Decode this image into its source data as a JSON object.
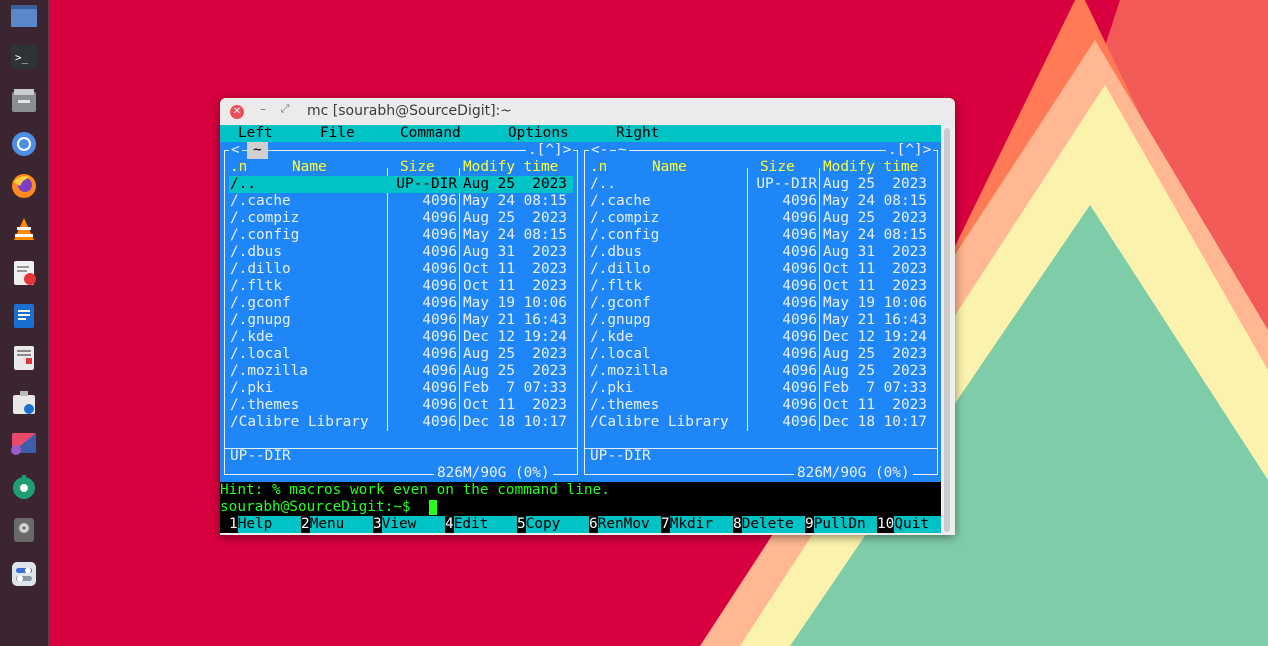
{
  "window": {
    "title": "mc [sourabh@SourceDigit]:~"
  },
  "menu": [
    "Left",
    "File",
    "Command",
    "Options",
    "Right"
  ],
  "left_panel": {
    "path_prefix": "<",
    "path": "~",
    "path_suffix": ".[^]>",
    "headers": {
      "sort": ".n",
      "name": "Name",
      "size": "Size",
      "time": "Modify time"
    },
    "rows": [
      {
        "name": "/..",
        "size": "UP--DIR",
        "time": "Aug 25  2023",
        "selected": true
      },
      {
        "name": "/.cache",
        "size": "4096",
        "time": "May 24 08:15"
      },
      {
        "name": "/.compiz",
        "size": "4096",
        "time": "Aug 25  2023"
      },
      {
        "name": "/.config",
        "size": "4096",
        "time": "May 24 08:15"
      },
      {
        "name": "/.dbus",
        "size": "4096",
        "time": "Aug 31  2023"
      },
      {
        "name": "/.dillo",
        "size": "4096",
        "time": "Oct 11  2023"
      },
      {
        "name": "/.fltk",
        "size": "4096",
        "time": "Oct 11  2023"
      },
      {
        "name": "/.gconf",
        "size": "4096",
        "time": "May 19 10:06"
      },
      {
        "name": "/.gnupg",
        "size": "4096",
        "time": "May 21 16:43"
      },
      {
        "name": "/.kde",
        "size": "4096",
        "time": "Dec 12 19:24"
      },
      {
        "name": "/.local",
        "size": "4096",
        "time": "Aug 25  2023"
      },
      {
        "name": "/.mozilla",
        "size": "4096",
        "time": "Aug 25  2023"
      },
      {
        "name": "/.pki",
        "size": "4096",
        "time": "Feb  7 07:33"
      },
      {
        "name": "/.themes",
        "size": "4096",
        "time": "Oct 11  2023"
      },
      {
        "name": "/Calibre Library",
        "size": "4096",
        "time": "Dec 18 10:17"
      }
    ],
    "status": "UP--DIR",
    "disk": "826M/90G (0%)"
  },
  "right_panel": {
    "path_prefix": "<-",
    "path": "~",
    "path_suffix": ".[^]>",
    "headers": {
      "sort": ".n",
      "name": "Name",
      "size": "Size",
      "time": "Modify time"
    },
    "rows": [
      {
        "name": "/..",
        "size": "UP--DIR",
        "time": "Aug 25  2023"
      },
      {
        "name": "/.cache",
        "size": "4096",
        "time": "May 24 08:15"
      },
      {
        "name": "/.compiz",
        "size": "4096",
        "time": "Aug 25  2023"
      },
      {
        "name": "/.config",
        "size": "4096",
        "time": "May 24 08:15"
      },
      {
        "name": "/.dbus",
        "size": "4096",
        "time": "Aug 31  2023"
      },
      {
        "name": "/.dillo",
        "size": "4096",
        "time": "Oct 11  2023"
      },
      {
        "name": "/.fltk",
        "size": "4096",
        "time": "Oct 11  2023"
      },
      {
        "name": "/.gconf",
        "size": "4096",
        "time": "May 19 10:06"
      },
      {
        "name": "/.gnupg",
        "size": "4096",
        "time": "May 21 16:43"
      },
      {
        "name": "/.kde",
        "size": "4096",
        "time": "Dec 12 19:24"
      },
      {
        "name": "/.local",
        "size": "4096",
        "time": "Aug 25  2023"
      },
      {
        "name": "/.mozilla",
        "size": "4096",
        "time": "Aug 25  2023"
      },
      {
        "name": "/.pki",
        "size": "4096",
        "time": "Feb  7 07:33"
      },
      {
        "name": "/.themes",
        "size": "4096",
        "time": "Oct 11  2023"
      },
      {
        "name": "/Calibre Library",
        "size": "4096",
        "time": "Dec 18 10:17"
      }
    ],
    "status": "UP--DIR",
    "disk": "826M/90G (0%)"
  },
  "hint": "Hint: % macros work even on the command line.",
  "prompt": "sourabh@SourceDigit:~$",
  "fkeys": [
    {
      "num": "1",
      "label": "Help"
    },
    {
      "num": "2",
      "label": "Menu"
    },
    {
      "num": "3",
      "label": "View"
    },
    {
      "num": "4",
      "label": "Edit"
    },
    {
      "num": "5",
      "label": "Copy"
    },
    {
      "num": "6",
      "label": "RenMov"
    },
    {
      "num": "7",
      "label": "Mkdir"
    },
    {
      "num": "8",
      "label": "Delete"
    },
    {
      "num": "9",
      "label": "PullDn"
    },
    {
      "num": "10",
      "label": "Quit"
    }
  ],
  "dock": [
    {
      "name": "show-desktop-icon"
    },
    {
      "name": "terminal-icon"
    },
    {
      "name": "file-manager-icon"
    },
    {
      "name": "chromium-icon"
    },
    {
      "name": "firefox-icon"
    },
    {
      "name": "vlc-icon"
    },
    {
      "name": "text-editor-icon"
    },
    {
      "name": "writer-icon"
    },
    {
      "name": "document-viewer-icon"
    },
    {
      "name": "software-install-icon"
    },
    {
      "name": "image-editor-icon"
    },
    {
      "name": "settings-gear-icon"
    },
    {
      "name": "disk-icon"
    },
    {
      "name": "toggles-icon"
    }
  ],
  "colors": {
    "desktop": "#d8003f",
    "panel": "#1f86f7",
    "menu": "#00c3c6",
    "header": "#ffff3c",
    "terminal_text": "#22ff22"
  }
}
